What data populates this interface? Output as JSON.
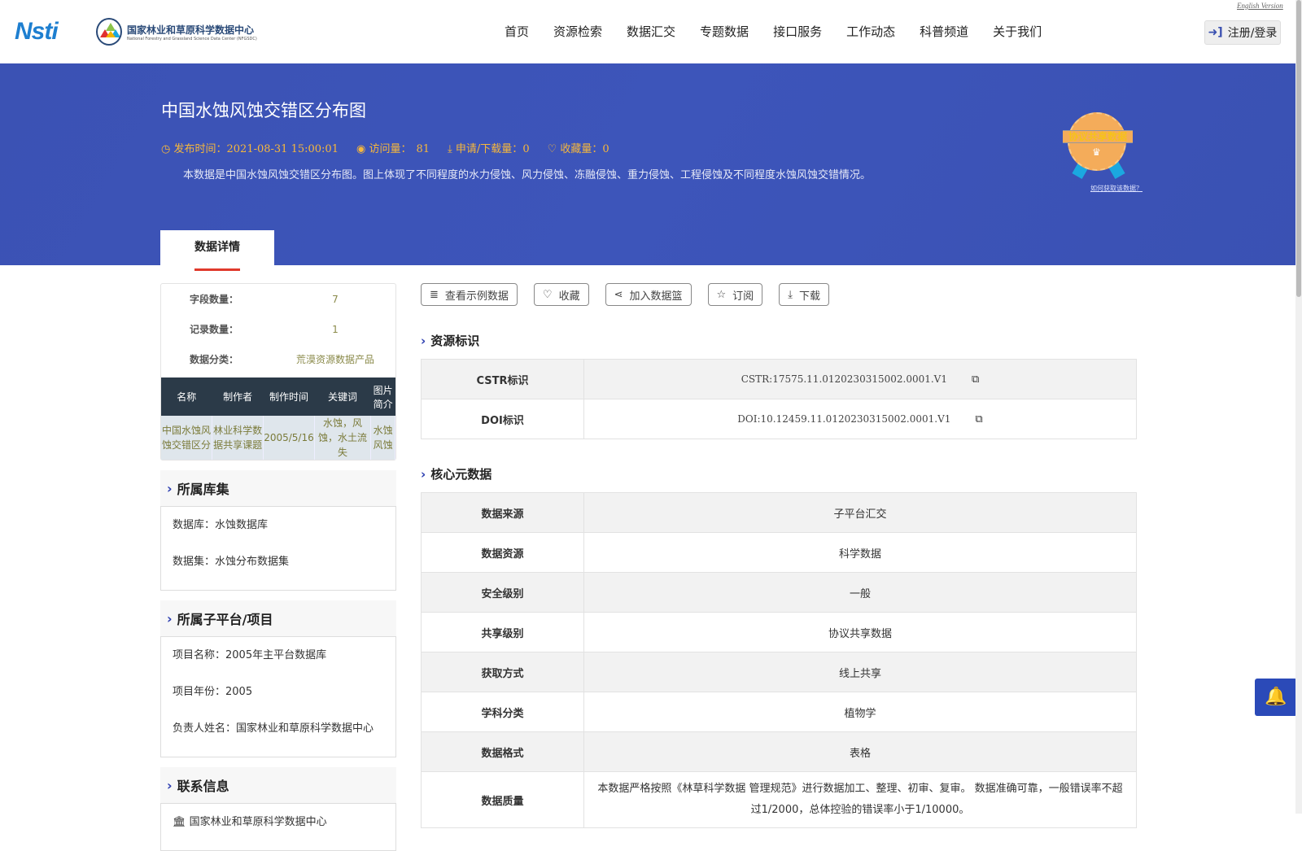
{
  "header": {
    "logo_nsti": "Nsti",
    "logo_title": "国家林业和草原科学数据中心",
    "logo_subtitle": "National Forestry and Grassland Science Data Center (NFGSDC)",
    "english_link": "English Version",
    "login_label": "注册/登录",
    "nav": [
      "首页",
      "资源检索",
      "数据汇交",
      "专题数据",
      "接口服务",
      "工作动态",
      "科普频道",
      "关于我们"
    ]
  },
  "banner": {
    "title": "中国水蚀风蚀交错区分布图",
    "publish_label": "发布时间：",
    "publish_time": "2021-08-31 15:00:01",
    "visits_label": "访问量：",
    "visits": "81",
    "downloads_label": "申请/下载量：",
    "downloads": "0",
    "favorites_label": "收藏量：",
    "favorites": "0",
    "description": "本数据是中国水蚀风蚀交错区分布图。图上体现了不同程度的水力侵蚀、风力侵蚀、冻融侵蚀、重力侵蚀、工程侵蚀及不同程度水蚀风蚀交错情况。",
    "badge_text": "协议共享数据",
    "howto_link": "如何获取该数据？"
  },
  "tab": "数据详情",
  "summary": {
    "fields_label": "字段数量：",
    "fields": "7",
    "records_label": "记录数量：",
    "records": "1",
    "category_label": "数据分类：",
    "category": "荒漠资源数据产品",
    "columns": [
      "名称",
      "制作者",
      "制作时间",
      "关键词",
      "图片简介"
    ],
    "row": [
      "中国水蚀风蚀交错区分",
      "林业科学数据共享课题",
      "2005/5/16",
      "水蚀，风蚀，水土流失",
      "水蚀风蚀"
    ]
  },
  "library": {
    "title": "所属库集",
    "database": "数据库：水蚀数据库",
    "dataset": "数据集：水蚀分布数据集"
  },
  "project": {
    "title": "所属子平台/项目",
    "name": "项目名称：2005年主平台数据库",
    "year": "项目年份：2005",
    "owner": "负责人姓名：国家林业和草原科学数据中心"
  },
  "contact": {
    "title": "联系信息",
    "org": "国家林业和草原科学数据中心"
  },
  "actions": [
    "查看示例数据",
    "收藏",
    "加入数据篮",
    "订阅",
    "下载"
  ],
  "identifiers": {
    "title": "资源标识",
    "rows": [
      {
        "label": "CSTR标识",
        "value": "CSTR:17575.11.0120230315002.0001.V1"
      },
      {
        "label": "DOI标识",
        "value": "DOI:10.12459.11.0120230315002.0001.V1"
      }
    ]
  },
  "core": {
    "title": "核心元数据",
    "rows": [
      {
        "label": "数据来源",
        "value": "子平台汇交"
      },
      {
        "label": "数据资源",
        "value": "科学数据"
      },
      {
        "label": "安全级别",
        "value": "一般"
      },
      {
        "label": "共享级别",
        "value": "协议共享数据"
      },
      {
        "label": "获取方式",
        "value": "线上共享"
      },
      {
        "label": "学科分类",
        "value": "植物学"
      },
      {
        "label": "数据格式",
        "value": "表格"
      },
      {
        "label": "数据质量",
        "value": "本数据严格按照《林草科学数据 管理规范》进行数据加工、整理、初审、复审。 数据准确可靠，一般错误率不超过1/2000，总体控验的错误率小于1/10000。"
      }
    ]
  }
}
